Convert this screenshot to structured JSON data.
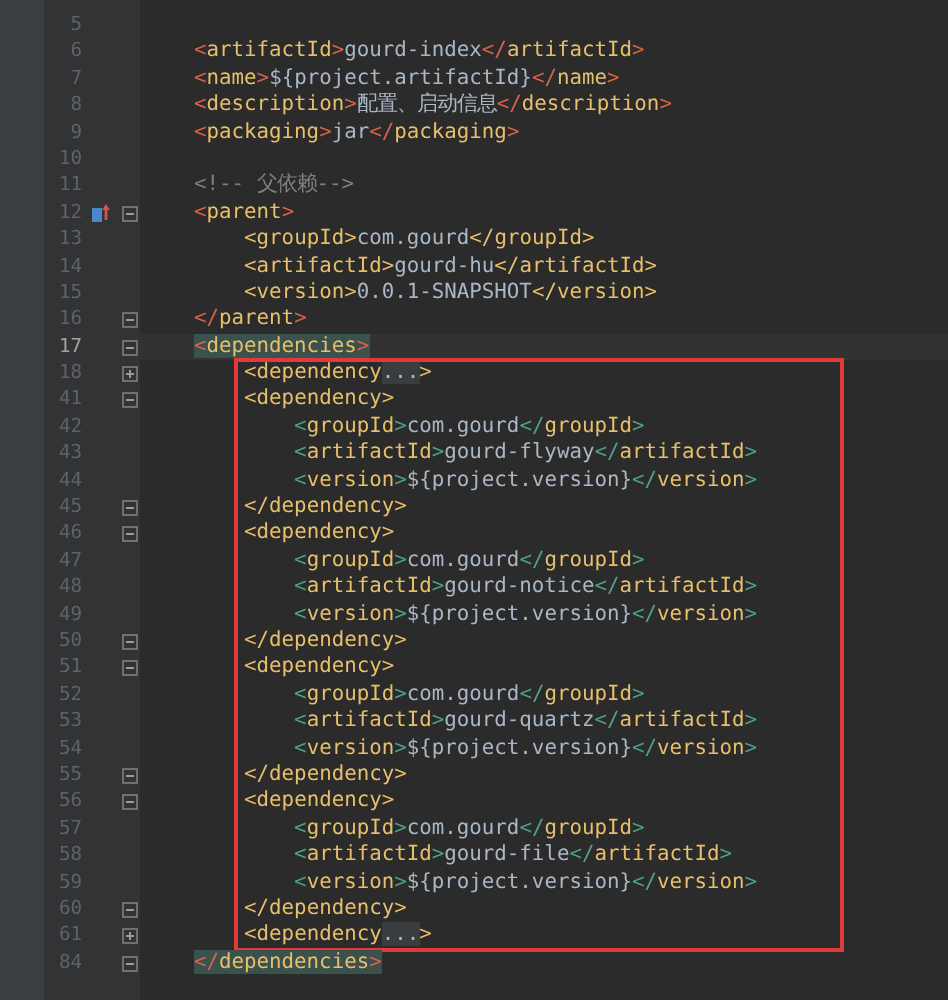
{
  "editor": {
    "sections": [
      {
        "kind": "plain",
        "lines": [
          {
            "number": "5",
            "current": false
          },
          {
            "number": "6",
            "current": false,
            "matched": false,
            "code": "<artifactId>gourd-index</artifactId>"
          },
          {
            "number": "7",
            "current": false,
            "matched": false,
            "code": "<name>${project.artifactId}</name>"
          },
          {
            "number": "8",
            "current": false,
            "matched": false,
            "code": "<description>配置、启动信息</description>"
          },
          {
            "number": "9",
            "current": false,
            "matched": false,
            "code": "<packaging>jar</packaging>"
          },
          {
            "number": "10",
            "current": false
          },
          {
            "number": "11",
            "current": false,
            "matched": false,
            "code": "<!-- 父依赖-->"
          },
          {
            "number": "12",
            "current": false,
            "matched": false,
            "marker": {
              "kind": "override"
            },
            "fold": {
              "collapsed": false
            },
            "code": "<parent>"
          },
          {
            "number": "13",
            "current": false,
            "matched": false,
            "code": "    <groupId>com.gourd</groupId>"
          },
          {
            "number": "14",
            "current": false,
            "matched": false,
            "code": "    <artifactId>gourd-hu</artifactId>"
          },
          {
            "number": "15",
            "current": false,
            "matched": false,
            "code": "    <version>0.0.1-SNAPSHOT</version>"
          },
          {
            "number": "16",
            "current": false,
            "matched": false,
            "fold": {
              "collapsed": false
            },
            "code": "</parent>"
          },
          {
            "number": "17",
            "current": true,
            "matched": true,
            "fold": {
              "collapsed": false
            },
            "code": "<dependencies>"
          }
        ]
      },
      {
        "kind": "boxed",
        "lines": [
          {
            "number": "18",
            "current": false,
            "matched": false,
            "fold": {
              "collapsed": true
            },
            "code": "    <dependency...>"
          },
          {
            "number": "41",
            "current": false,
            "matched": false,
            "fold": {
              "collapsed": false
            },
            "code": "    <dependency>"
          },
          {
            "number": "42",
            "current": false,
            "matched": false,
            "code": "        <groupId>com.gourd</groupId>"
          },
          {
            "number": "43",
            "current": false,
            "matched": false,
            "code": "        <artifactId>gourd-flyway</artifactId>"
          },
          {
            "number": "44",
            "current": false,
            "matched": false,
            "code": "        <version>${project.version}</version>"
          },
          {
            "number": "45",
            "current": false,
            "matched": false,
            "fold": {
              "collapsed": false
            },
            "code": "    </dependency>"
          },
          {
            "number": "46",
            "current": false,
            "matched": false,
            "fold": {
              "collapsed": false
            },
            "code": "    <dependency>"
          },
          {
            "number": "47",
            "current": false,
            "matched": false,
            "code": "        <groupId>com.gourd</groupId>"
          },
          {
            "number": "48",
            "current": false,
            "matched": false,
            "code": "        <artifactId>gourd-notice</artifactId>"
          },
          {
            "number": "49",
            "current": false,
            "matched": false,
            "code": "        <version>${project.version}</version>"
          },
          {
            "number": "50",
            "current": false,
            "matched": false,
            "fold": {
              "collapsed": false
            },
            "code": "    </dependency>"
          },
          {
            "number": "51",
            "current": false,
            "matched": false,
            "fold": {
              "collapsed": false
            },
            "code": "    <dependency>"
          },
          {
            "number": "52",
            "current": false,
            "matched": false,
            "code": "        <groupId>com.gourd</groupId>"
          },
          {
            "number": "53",
            "current": false,
            "matched": false,
            "code": "        <artifactId>gourd-quartz</artifactId>"
          },
          {
            "number": "54",
            "current": false,
            "matched": false,
            "code": "        <version>${project.version}</version>"
          },
          {
            "number": "55",
            "current": false,
            "matched": false,
            "fold": {
              "collapsed": false
            },
            "code": "    </dependency>"
          },
          {
            "number": "56",
            "current": false,
            "matched": false,
            "fold": {
              "collapsed": false
            },
            "code": "    <dependency>"
          },
          {
            "number": "57",
            "current": false,
            "matched": false,
            "code": "        <groupId>com.gourd</groupId>"
          },
          {
            "number": "58",
            "current": false,
            "matched": false,
            "code": "        <artifactId>gourd-file</artifactId>"
          },
          {
            "number": "59",
            "current": false,
            "matched": false,
            "code": "        <version>${project.version}</version>"
          },
          {
            "number": "60",
            "current": false,
            "matched": false,
            "fold": {
              "collapsed": false
            },
            "code": "    </dependency>"
          },
          {
            "number": "61",
            "current": false,
            "matched": false,
            "fold": {
              "collapsed": true
            },
            "code": "    <dependency...>"
          }
        ]
      },
      {
        "kind": "plain",
        "lines": [
          {
            "number": "84",
            "current": false,
            "matched": true,
            "fold": {
              "collapsed": false
            },
            "code": "</dependencies>"
          }
        ]
      }
    ]
  }
}
